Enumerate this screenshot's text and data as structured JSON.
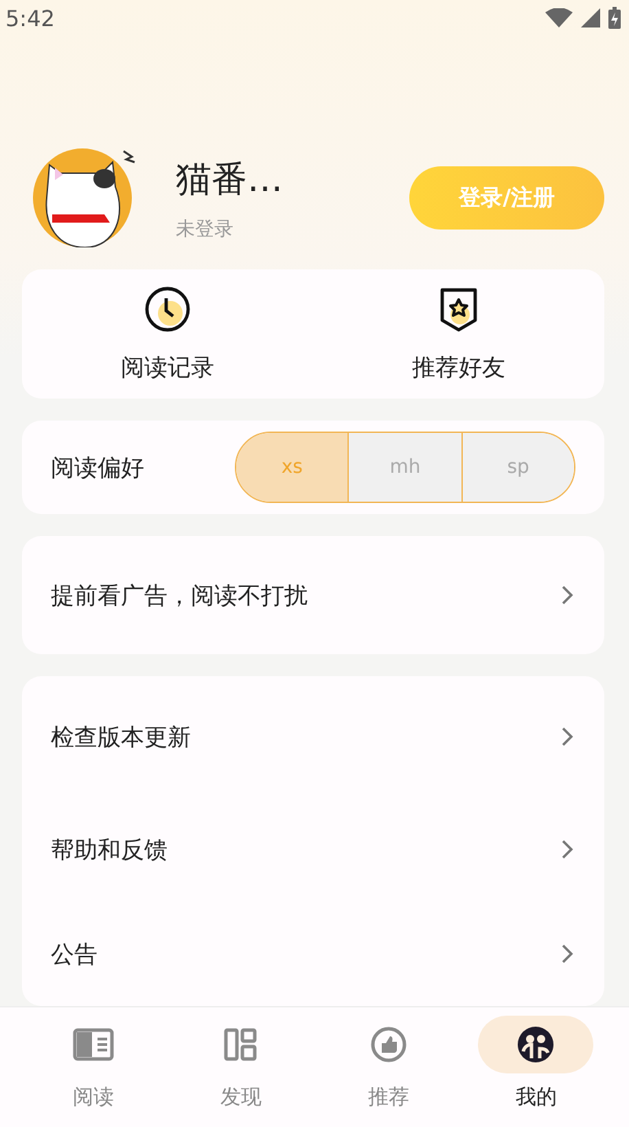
{
  "status_bar": {
    "time": "5:42"
  },
  "profile": {
    "name": "猫番…",
    "status": "未登录",
    "login_button": "登录/注册"
  },
  "shortcuts": [
    {
      "kind": "clock",
      "label": "阅读记录"
    },
    {
      "kind": "badge",
      "label": "推荐好友"
    }
  ],
  "preference": {
    "label": "阅读偏好",
    "options": [
      {
        "label": "xs",
        "selected": true
      },
      {
        "label": "mh",
        "selected": false
      },
      {
        "label": "sp",
        "selected": false
      }
    ]
  },
  "ad_row": {
    "label": "提前看广告，阅读不打扰"
  },
  "menu": [
    {
      "label": "检查版本更新"
    },
    {
      "label": "帮助和反馈"
    },
    {
      "label": "公告"
    }
  ],
  "bottom_nav": [
    {
      "kind": "read",
      "label": "阅读",
      "selected": false
    },
    {
      "kind": "discover",
      "label": "发现",
      "selected": false
    },
    {
      "kind": "recommend",
      "label": "推荐",
      "selected": false
    },
    {
      "kind": "mine",
      "label": "我的",
      "selected": true
    }
  ]
}
